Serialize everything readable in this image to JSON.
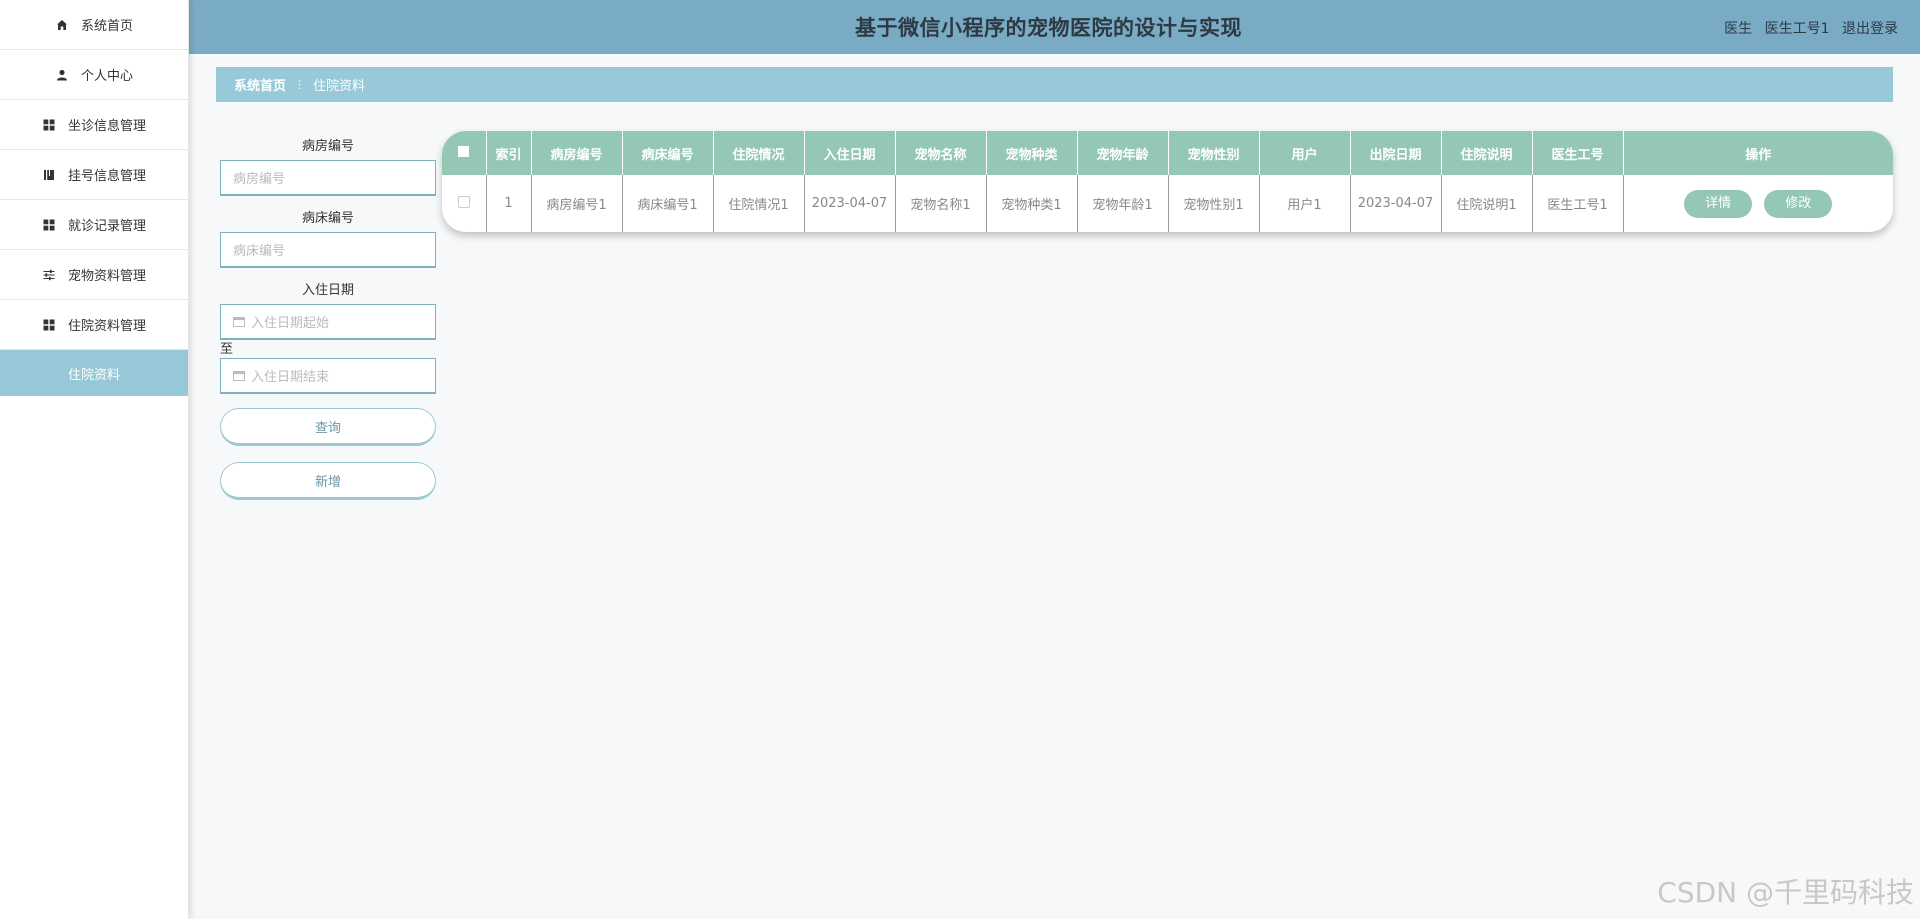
{
  "header": {
    "title": "基于微信小程序的宠物医院的设计与实现",
    "role": "医生",
    "user": "医生工号1",
    "logout": "退出登录"
  },
  "sidebar": {
    "items": [
      {
        "label": "系统首页",
        "icon": "home-icon"
      },
      {
        "label": "个人中心",
        "icon": "user-icon"
      },
      {
        "label": "坐诊信息管理",
        "icon": "grid-icon"
      },
      {
        "label": "挂号信息管理",
        "icon": "book-icon"
      },
      {
        "label": "就诊记录管理",
        "icon": "grid-icon"
      },
      {
        "label": "宠物资料管理",
        "icon": "sliders-icon"
      },
      {
        "label": "住院资料管理",
        "icon": "grid-icon"
      }
    ],
    "active_sub": "住院资料"
  },
  "breadcrumb": {
    "home": "系统首页",
    "current": "住院资料"
  },
  "search": {
    "room_label": "病房编号",
    "room_placeholder": "病房编号",
    "bed_label": "病床编号",
    "bed_placeholder": "病床编号",
    "date_label": "入住日期",
    "date_start_placeholder": "入住日期起始",
    "to": "至",
    "date_end_placeholder": "入住日期结束",
    "query_button": "查询",
    "add_button": "新增"
  },
  "table": {
    "columns": [
      "索引",
      "病房编号",
      "病床编号",
      "住院情况",
      "入住日期",
      "宠物名称",
      "宠物种类",
      "宠物年龄",
      "宠物性别",
      "用户",
      "出院日期",
      "住院说明",
      "医生工号",
      "操作"
    ],
    "rows": [
      [
        "1",
        "病房编号1",
        "病床编号1",
        "住院情况1",
        "2023-04-07",
        "宠物名称1",
        "宠物种类1",
        "宠物年龄1",
        "宠物性别1",
        "用户1",
        "2023-04-07",
        "住院说明1",
        "医生工号1"
      ]
    ],
    "detail_button": "详情",
    "edit_button": "修改"
  },
  "watermark": "CSDN @千里码科技",
  "colors": {
    "header_bg": "#7aabc4",
    "breadcrumb_bg": "#98c9d8",
    "table_header_bg": "#94c8b5",
    "sidebar_active_bg": "#97c8d8"
  }
}
